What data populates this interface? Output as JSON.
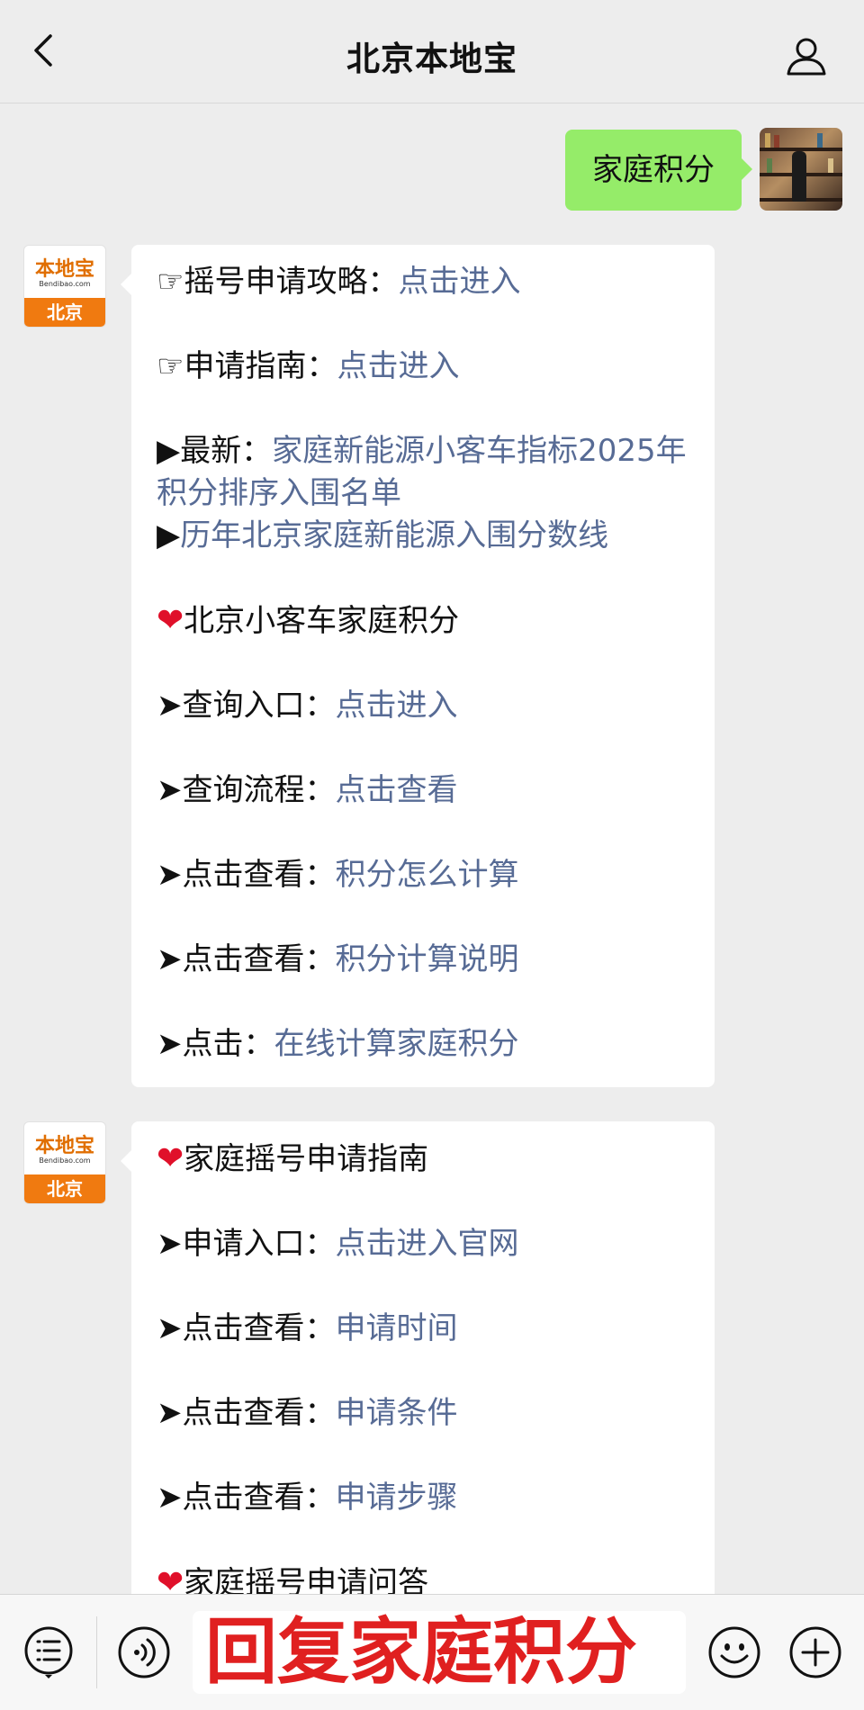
{
  "header": {
    "title": "北京本地宝"
  },
  "outgoing": {
    "text": "家庭积分"
  },
  "account": {
    "logo_top": "本地宝",
    "logo_url": "Bendibao.com",
    "logo_bottom": "北京"
  },
  "message1": {
    "l1": {
      "prefix": "☞摇号申请攻略：",
      "link": "点击进入"
    },
    "l2": {
      "prefix": "☞申请指南：",
      "link": "点击进入"
    },
    "l3": {
      "prefix": "▶最新：",
      "link": "家庭新能源小客车指标2025年积分排序入围名单"
    },
    "l4": {
      "prefix": "▶",
      "link": "历年北京家庭新能源入围分数线"
    },
    "heading": {
      "heart": "❤",
      "text": "北京小客车家庭积分"
    },
    "l5": {
      "prefix": "➤查询入口：",
      "link": "点击进入"
    },
    "l6": {
      "prefix": "➤查询流程：",
      "link": "点击查看"
    },
    "l7": {
      "prefix": "➤点击查看：",
      "link": "积分怎么计算"
    },
    "l8": {
      "prefix": "➤点击查看：",
      "link": "积分计算说明"
    },
    "l9": {
      "prefix": "➤点击：",
      "link": "在线计算家庭积分"
    }
  },
  "message2": {
    "heading": {
      "heart": "❤",
      "text": "家庭摇号申请指南"
    },
    "l1": {
      "prefix": "➤申请入口：",
      "link": "点击进入官网"
    },
    "l2": {
      "prefix": "➤点击查看：",
      "link": "申请时间"
    },
    "l3": {
      "prefix": "➤点击查看：",
      "link": "申请条件"
    },
    "l4": {
      "prefix": "➤点击查看：",
      "link": "申请步骤"
    },
    "heading2": {
      "heart": "❤",
      "text": "家庭摇号申请问答"
    }
  },
  "input": {
    "text": "回复家庭积分"
  },
  "icons": {
    "back": "chevron-left-icon",
    "user": "user-icon",
    "menu": "menu-list-icon",
    "voice": "voice-icon",
    "emoji": "emoji-icon",
    "plus": "plus-icon"
  },
  "colors": {
    "link": "#576b95",
    "outgoing_bubble": "#95ec69",
    "heart": "#e0102a",
    "input_text": "#e02020",
    "logo_orange": "#f07a10"
  }
}
